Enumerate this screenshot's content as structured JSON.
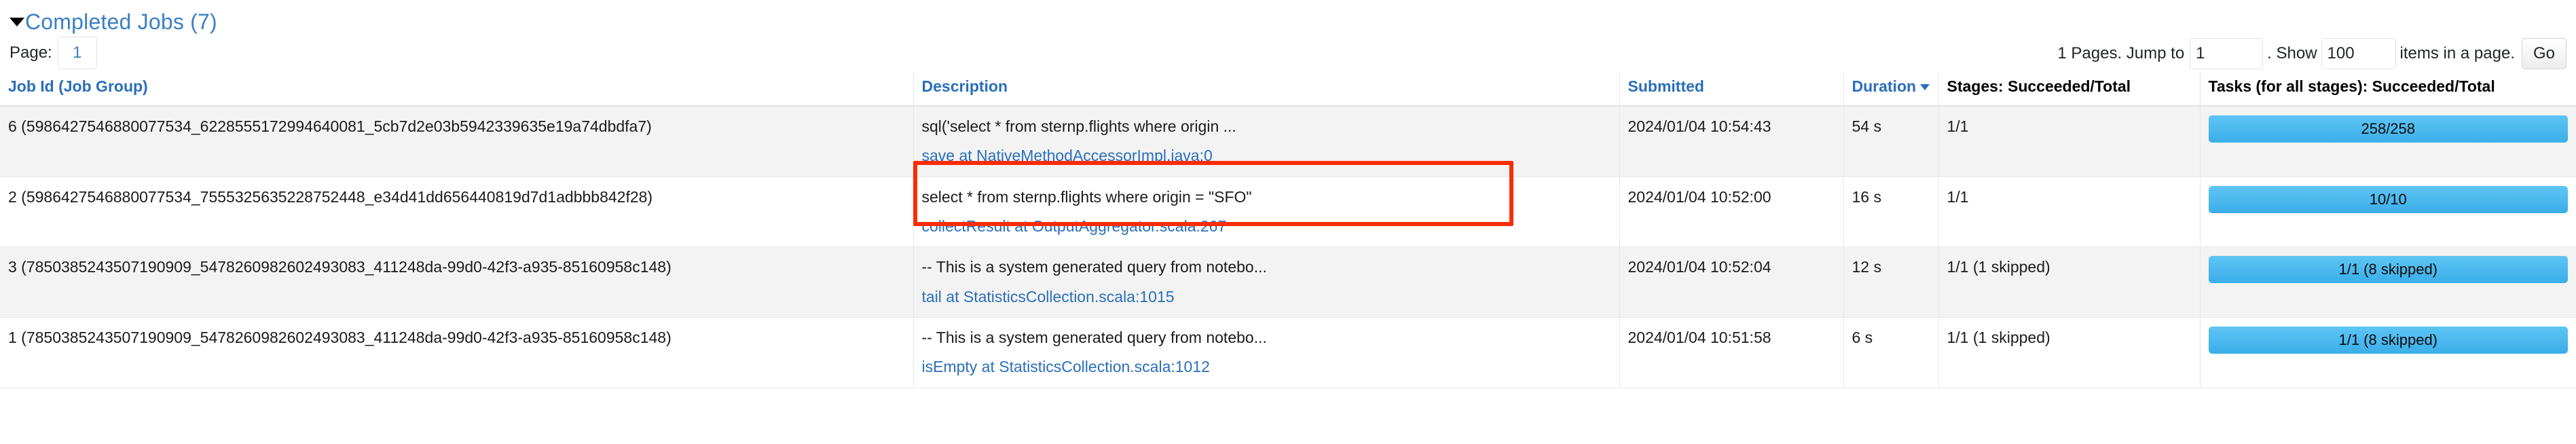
{
  "section": {
    "title": "Completed Jobs (7)",
    "caret_icon": "caret-down-icon"
  },
  "pagination": {
    "page_label": "Page:",
    "current_page": "1",
    "pages_text": "1 Pages. Jump to",
    "jump_value": "1",
    "show_text": ". Show",
    "show_value": "100",
    "items_text": "items in a page.",
    "go_label": "Go"
  },
  "table": {
    "columns": [
      {
        "label": "Job Id (Job Group)",
        "sortable": true,
        "sorted": false
      },
      {
        "label": "Description",
        "sortable": true,
        "sorted": false
      },
      {
        "label": "Submitted",
        "sortable": true,
        "sorted": false
      },
      {
        "label": "Duration",
        "sortable": true,
        "sorted": true,
        "sort_icon": "sort-descending-icon"
      },
      {
        "label": "Stages: Succeeded/Total",
        "sortable": false,
        "sorted": false
      },
      {
        "label": "Tasks (for all stages): Succeeded/Total",
        "sortable": false,
        "sorted": false
      }
    ],
    "rows": [
      {
        "job_id": "6 (5986427546880077534_6228555172994640081_5cb7d2e03b5942339635e19a74dbdfa7)",
        "description": "sql('select * from sternp.flights where origin ...",
        "description_link": "save at NativeMethodAccessorImpl.java:0",
        "submitted": "2024/01/04 10:54:43",
        "duration": "54 s",
        "stages": "1/1",
        "tasks": "258/258",
        "tasks_percent": 100
      },
      {
        "job_id": "2 (5986427546880077534_7555325635228752448_e34d41dd656440819d7d1adbbb842f28)",
        "description": "select * from sternp.flights where origin = \"SFO\"",
        "description_link": "collectResult at OutputAggregator.scala:267",
        "submitted": "2024/01/04 10:52:00",
        "duration": "16 s",
        "stages": "1/1",
        "tasks": "10/10",
        "tasks_percent": 100
      },
      {
        "job_id": "3 (7850385243507190909_5478260982602493083_411248da-99d0-42f3-a935-85160958c148)",
        "description": "-- This is a system generated query from notebo...",
        "description_link": "tail at StatisticsCollection.scala:1015",
        "submitted": "2024/01/04 10:52:04",
        "duration": "12 s",
        "stages": "1/1 (1 skipped)",
        "tasks": "1/1 (8 skipped)",
        "tasks_percent": 100
      },
      {
        "job_id": "1 (7850385243507190909_5478260982602493083_411248da-99d0-42f3-a935-85160958c148)",
        "description": "-- This is a system generated query from notebo...",
        "description_link": "isEmpty at StatisticsCollection.scala:1012",
        "submitted": "2024/01/04 10:51:58",
        "duration": "6 s",
        "stages": "1/1 (1 skipped)",
        "tasks": "1/1 (8 skipped)",
        "tasks_percent": 100
      }
    ]
  },
  "annotation": {
    "highlight_target": "row-1-description-cell",
    "color": "#fb2c05"
  }
}
